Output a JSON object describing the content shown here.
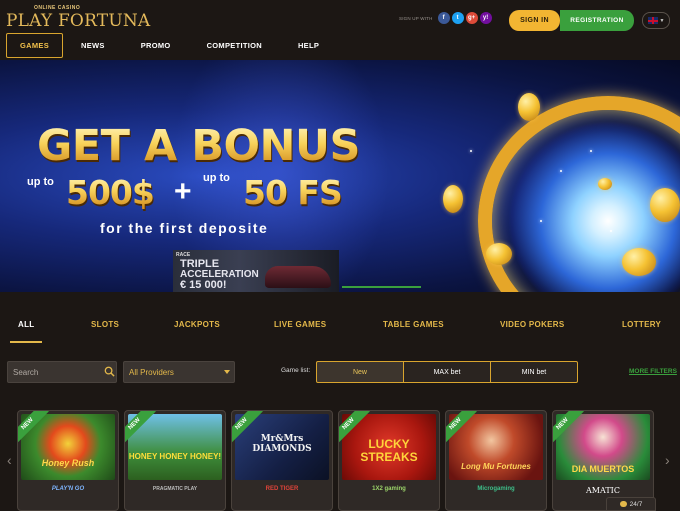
{
  "header": {
    "logo_sub": "ONLINE CASINO",
    "logo_main": "PLAY FORTUNA",
    "signup_label": "SIGN UP WITH",
    "social": [
      "f",
      "t",
      "g+",
      "y!"
    ],
    "signin_label": "SIGN IN",
    "register_label": "REGISTRATION",
    "language_icon": "uk-flag-icon"
  },
  "nav": {
    "items": [
      "GAMES",
      "NEWS",
      "PROMO",
      "COMPETITION",
      "HELP"
    ],
    "active": "GAMES"
  },
  "banner": {
    "title": "GET A BONUS",
    "upto_1": "up to",
    "amount": "500$",
    "plus": "+",
    "upto_2": "up to",
    "fs": "50 FS",
    "subtitle": "for the first deposite",
    "promo": {
      "small": "RACE",
      "line1": "TRIPLE",
      "line2": "ACCELERATION",
      "line3": "€ 15 000!"
    }
  },
  "categories": {
    "items": [
      "ALL",
      "SLOTS",
      "JACKPOTS",
      "LIVE GAMES",
      "TABLE GAMES",
      "VIDEO POKERS",
      "LOTTERY"
    ],
    "active": "ALL"
  },
  "filters": {
    "search_placeholder": "Search",
    "providers_value": "All Providers",
    "gamelist_label": "Game list:",
    "segments": [
      "New",
      "MAX bet",
      "MIN bet"
    ],
    "active_segment": "New",
    "more_filters": "MORE FILTERS"
  },
  "games": [
    {
      "title": "Honey Rush",
      "provider": "PLAY'N GO",
      "badge": "NEW",
      "bg": "#2f6d2a"
    },
    {
      "title": "HONEY HONEY HONEY!",
      "provider": "PRAGMATIC PLAY",
      "badge": "NEW",
      "bg": "#2f7f3a"
    },
    {
      "title": "Mr&Mrs DIAMONDS",
      "provider": "RED TIGER",
      "badge": "NEW",
      "bg": "#1e2e5a"
    },
    {
      "title": "LUCKY STREAKS",
      "provider": "1X2 gaming",
      "badge": "NEW",
      "bg": "#b5221c"
    },
    {
      "title": "Long Mu Fortunes",
      "provider": "Microgaming",
      "badge": "NEW",
      "bg": "#7a1f1c"
    },
    {
      "title": "DIA MUERTOS",
      "provider": "AMATIC",
      "badge": "NEW",
      "bg": "#3a8a3a"
    }
  ],
  "chat": {
    "label": "24/7"
  }
}
